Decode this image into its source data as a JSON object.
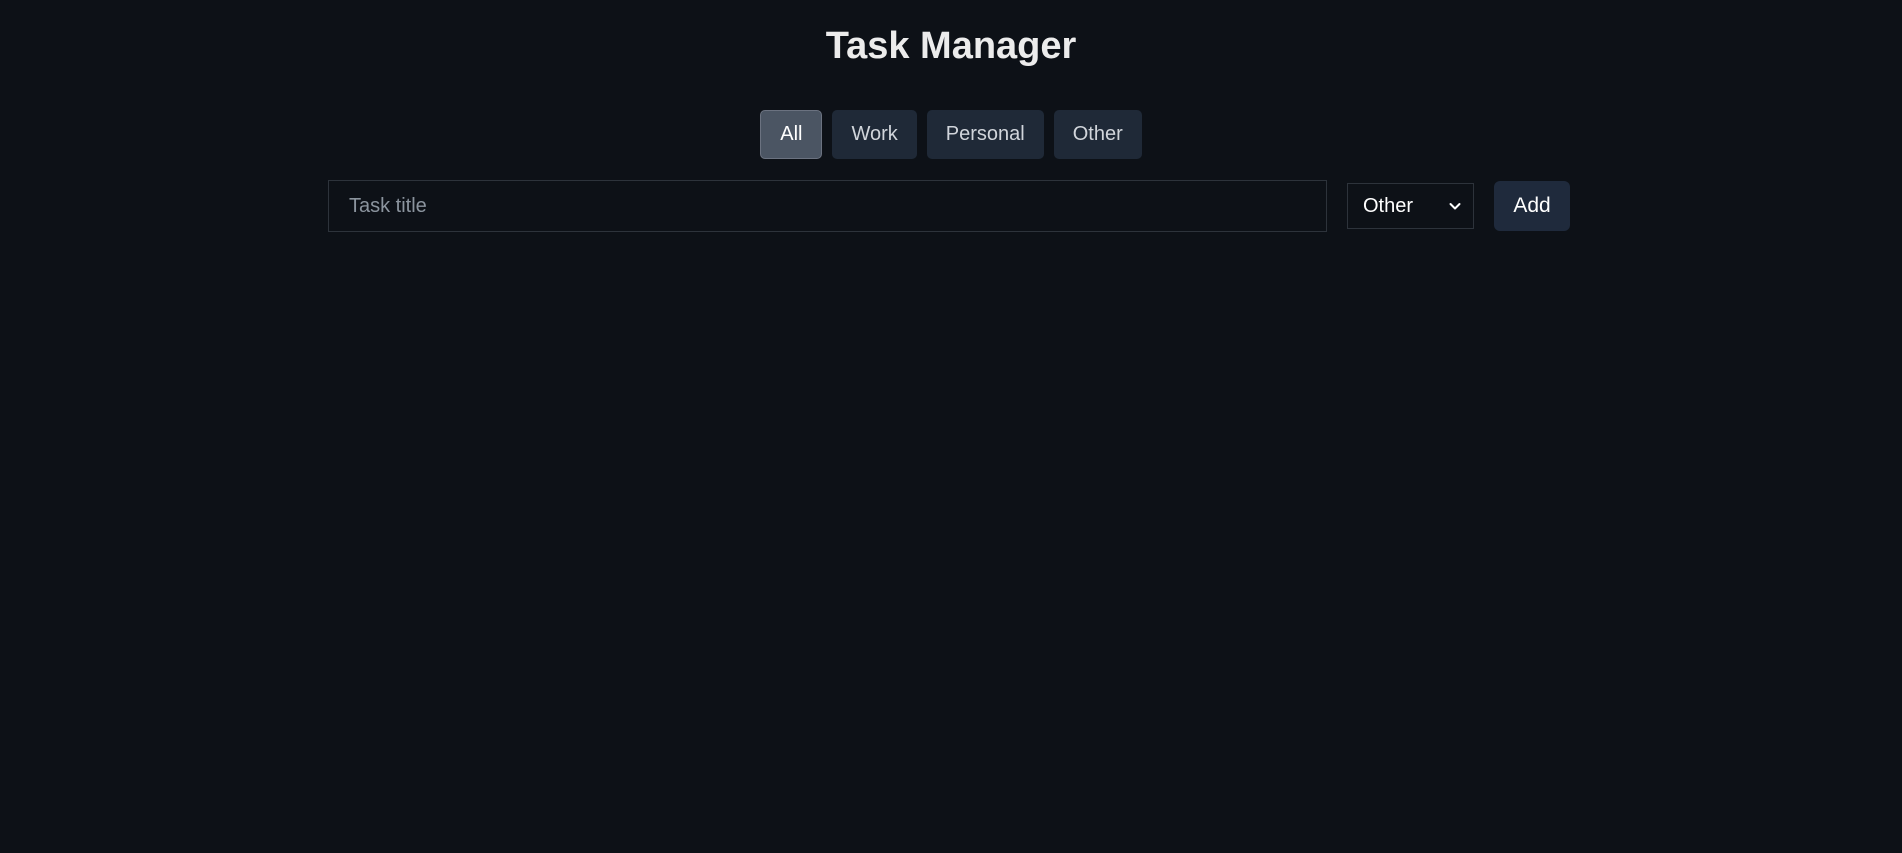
{
  "header": {
    "title": "Task Manager"
  },
  "filters": {
    "items": [
      {
        "label": "All",
        "active": true
      },
      {
        "label": "Work",
        "active": false
      },
      {
        "label": "Personal",
        "active": false
      },
      {
        "label": "Other",
        "active": false
      }
    ]
  },
  "form": {
    "title_placeholder": "Task title",
    "title_value": "",
    "category_selected": "Other",
    "add_label": "Add"
  },
  "tasks": [],
  "colors": {
    "background": "#0d1117",
    "button": "#1f2937",
    "active_button": "#4b5563"
  }
}
